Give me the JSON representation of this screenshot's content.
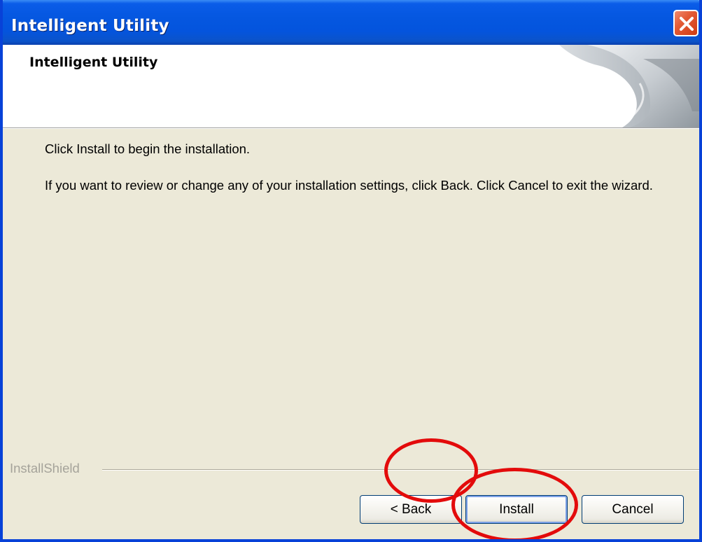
{
  "window": {
    "title": "Intelligent Utility"
  },
  "header": {
    "title": "Intelligent Utility"
  },
  "body": {
    "line1": "Click Install to begin the installation.",
    "line2": "If you want to review or change any of your installation settings, click Back. Click Cancel to exit the wizard."
  },
  "brand": {
    "label": "InstallShield"
  },
  "buttons": {
    "back": "< Back",
    "install": "Install",
    "cancel": "Cancel"
  },
  "colors": {
    "titlebar": "#0557e0",
    "dialog_bg": "#ece9d8",
    "annotation": "#e30b0b"
  }
}
